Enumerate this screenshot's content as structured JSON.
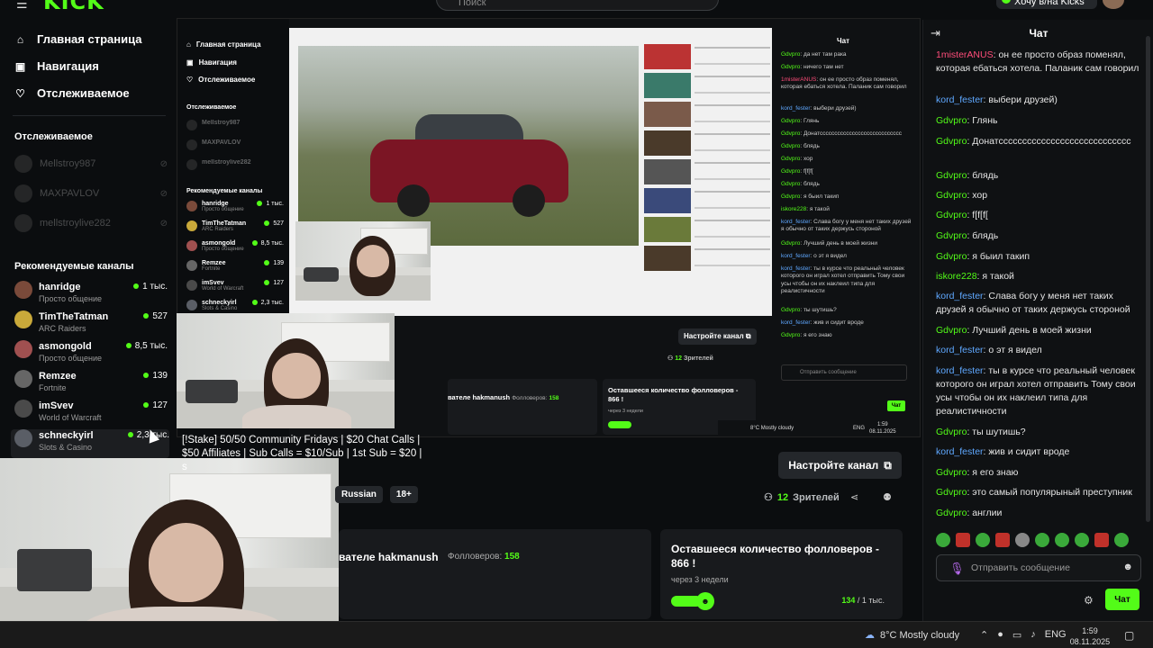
{
  "header": {
    "logo": "KICK",
    "search_placeholder": "Поиск",
    "top_button": "Хочу в/на Kicks"
  },
  "sidebar": {
    "nav": [
      {
        "label": "Главная страница",
        "icon": "home-icon"
      },
      {
        "label": "Навигация",
        "icon": "compass-icon"
      },
      {
        "label": "Отслеживаемое",
        "icon": "heart-icon"
      }
    ],
    "following_title": "Отслеживаемое",
    "following": [
      "Mellstroy987",
      "MAXPAVLOV",
      "mellstroylive282"
    ],
    "recommended_title": "Рекомендуемые каналы",
    "recommended": [
      {
        "name": "hanridge",
        "category": "Просто общение",
        "viewers": "1 тыс."
      },
      {
        "name": "TimTheTatman",
        "category": "ARC Raiders",
        "viewers": "527"
      },
      {
        "name": "asmongold",
        "category": "Просто общение",
        "viewers": "8,5 тыс."
      },
      {
        "name": "Remzee",
        "category": "Fortnite",
        "viewers": "139"
      },
      {
        "name": "imSvev",
        "category": "World of Warcraft",
        "viewers": "127"
      },
      {
        "name": "schneckyirl",
        "category": "Slots & Casino",
        "viewers": "2,3 тыс."
      }
    ]
  },
  "stream": {
    "title_text": "[!Stake] 50/50 Community Fridays | $20 Chat Calls | $50 Affiliates | Sub Calls = $10/Sub | 1st Sub = $20 | s",
    "tags": [
      "Russian",
      "18+"
    ],
    "setup_button": "Настройте канал",
    "viewers_count": "12",
    "viewers_label": "Зрителей",
    "followers_title": "вателе hakmanush",
    "followers_label": "Фолловеров:",
    "followers_count": "158",
    "goal_title": "Оставшееся количество фолловеров - 866 !",
    "goal_sub": "через 3 недели",
    "goal_current": "134",
    "goal_total": "/ 1 тыс.",
    "goal_progress": 0.134
  },
  "chat": {
    "title": "Чат",
    "messages": [
      {
        "user": "1misterANUS",
        "color": "m",
        "text": "он ее просто образ поменял, которая ебаться хотела. Паланик сам говорил"
      },
      {
        "user": "kord_fester",
        "color": "b",
        "text": "выбери друзей)"
      },
      {
        "user": "Gdvpro",
        "color": "g",
        "text": "Глянь"
      },
      {
        "user": "Gdvpro",
        "color": "g",
        "text": "Донатсссссссссссссссссссссссссссс"
      },
      {
        "user": "Gdvpro",
        "color": "g",
        "text": "блядь"
      },
      {
        "user": "Gdvpro",
        "color": "g",
        "text": "хор"
      },
      {
        "user": "Gdvpro",
        "color": "g",
        "text": "f[f[f["
      },
      {
        "user": "Gdvpro",
        "color": "g",
        "text": "блядь"
      },
      {
        "user": "Gdvpro",
        "color": "g",
        "text": "я быил такип"
      },
      {
        "user": "iskore228",
        "color": "g",
        "text": "я такой"
      },
      {
        "user": "kord_fester",
        "color": "b",
        "text": "Слава богу у меня нет таких друзей я обычно от таких держусь стороной"
      },
      {
        "user": "Gdvpro",
        "color": "g",
        "text": "Лучший день в моей жизни"
      },
      {
        "user": "kord_fester",
        "color": "b",
        "text": "о эт я видел"
      },
      {
        "user": "kord_fester",
        "color": "b",
        "text": "ты в курсе что реальный человек которого он играл хотел отправить Тому свои усы чтобы он их наклеил типа для реалистичности"
      },
      {
        "user": "Gdvpro",
        "color": "g",
        "text": "ты шутишь?"
      },
      {
        "user": "kord_fester",
        "color": "b",
        "text": "жив и сидит вроде"
      },
      {
        "user": "Gdvpro",
        "color": "g",
        "text": "я его знаю"
      },
      {
        "user": "Gdvpro",
        "color": "g",
        "text": "это самый популярыный преступник"
      },
      {
        "user": "Gdvpro",
        "color": "g",
        "text": "англии"
      }
    ],
    "input_placeholder": "Отправить сообщение",
    "send_label": "Чат"
  },
  "taskbar": {
    "weather": "8°C  Mostly cloudy",
    "lang": "ENG",
    "time": "1:59",
    "date": "08.11.2025"
  },
  "colors": {
    "accent": "#53fc18",
    "bg": "#0b0d0f",
    "panel": "#181a1d",
    "user_blue": "#5fa8ff",
    "user_pink": "#ff4d7a"
  }
}
